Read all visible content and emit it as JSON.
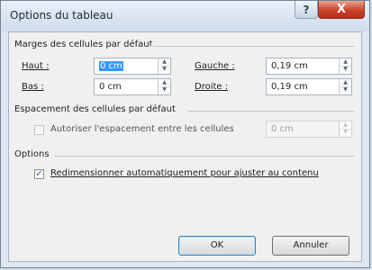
{
  "window": {
    "title": "Options du tableau",
    "help_glyph": "?",
    "close_glyph": "X"
  },
  "margins": {
    "heading": "Marges des cellules par défaut",
    "top": {
      "label": "Haut :",
      "value": "0 cm"
    },
    "left": {
      "label": "Gauche :",
      "value": "0,19 cm"
    },
    "bottom": {
      "label": "Bas :",
      "value": "0 cm"
    },
    "right": {
      "label": "Droite :",
      "value": "0,19 cm"
    }
  },
  "spacing": {
    "heading": "Espacement des cellules par défaut",
    "checkbox_label": "Autoriser l'espacement entre les cellules",
    "checked": false,
    "value": "0 cm"
  },
  "options": {
    "heading": "Options",
    "autoresize_label": "Redimensionner automatiquement pour ajuster au contenu",
    "autoresize_checked": true,
    "check_glyph": "✓"
  },
  "buttons": {
    "ok": "OK",
    "cancel": "Annuler"
  },
  "icons": {
    "spin_up": "▲",
    "spin_down": "▼"
  },
  "colors": {
    "selection": "#3399ff",
    "close_button": "#c8432a"
  }
}
